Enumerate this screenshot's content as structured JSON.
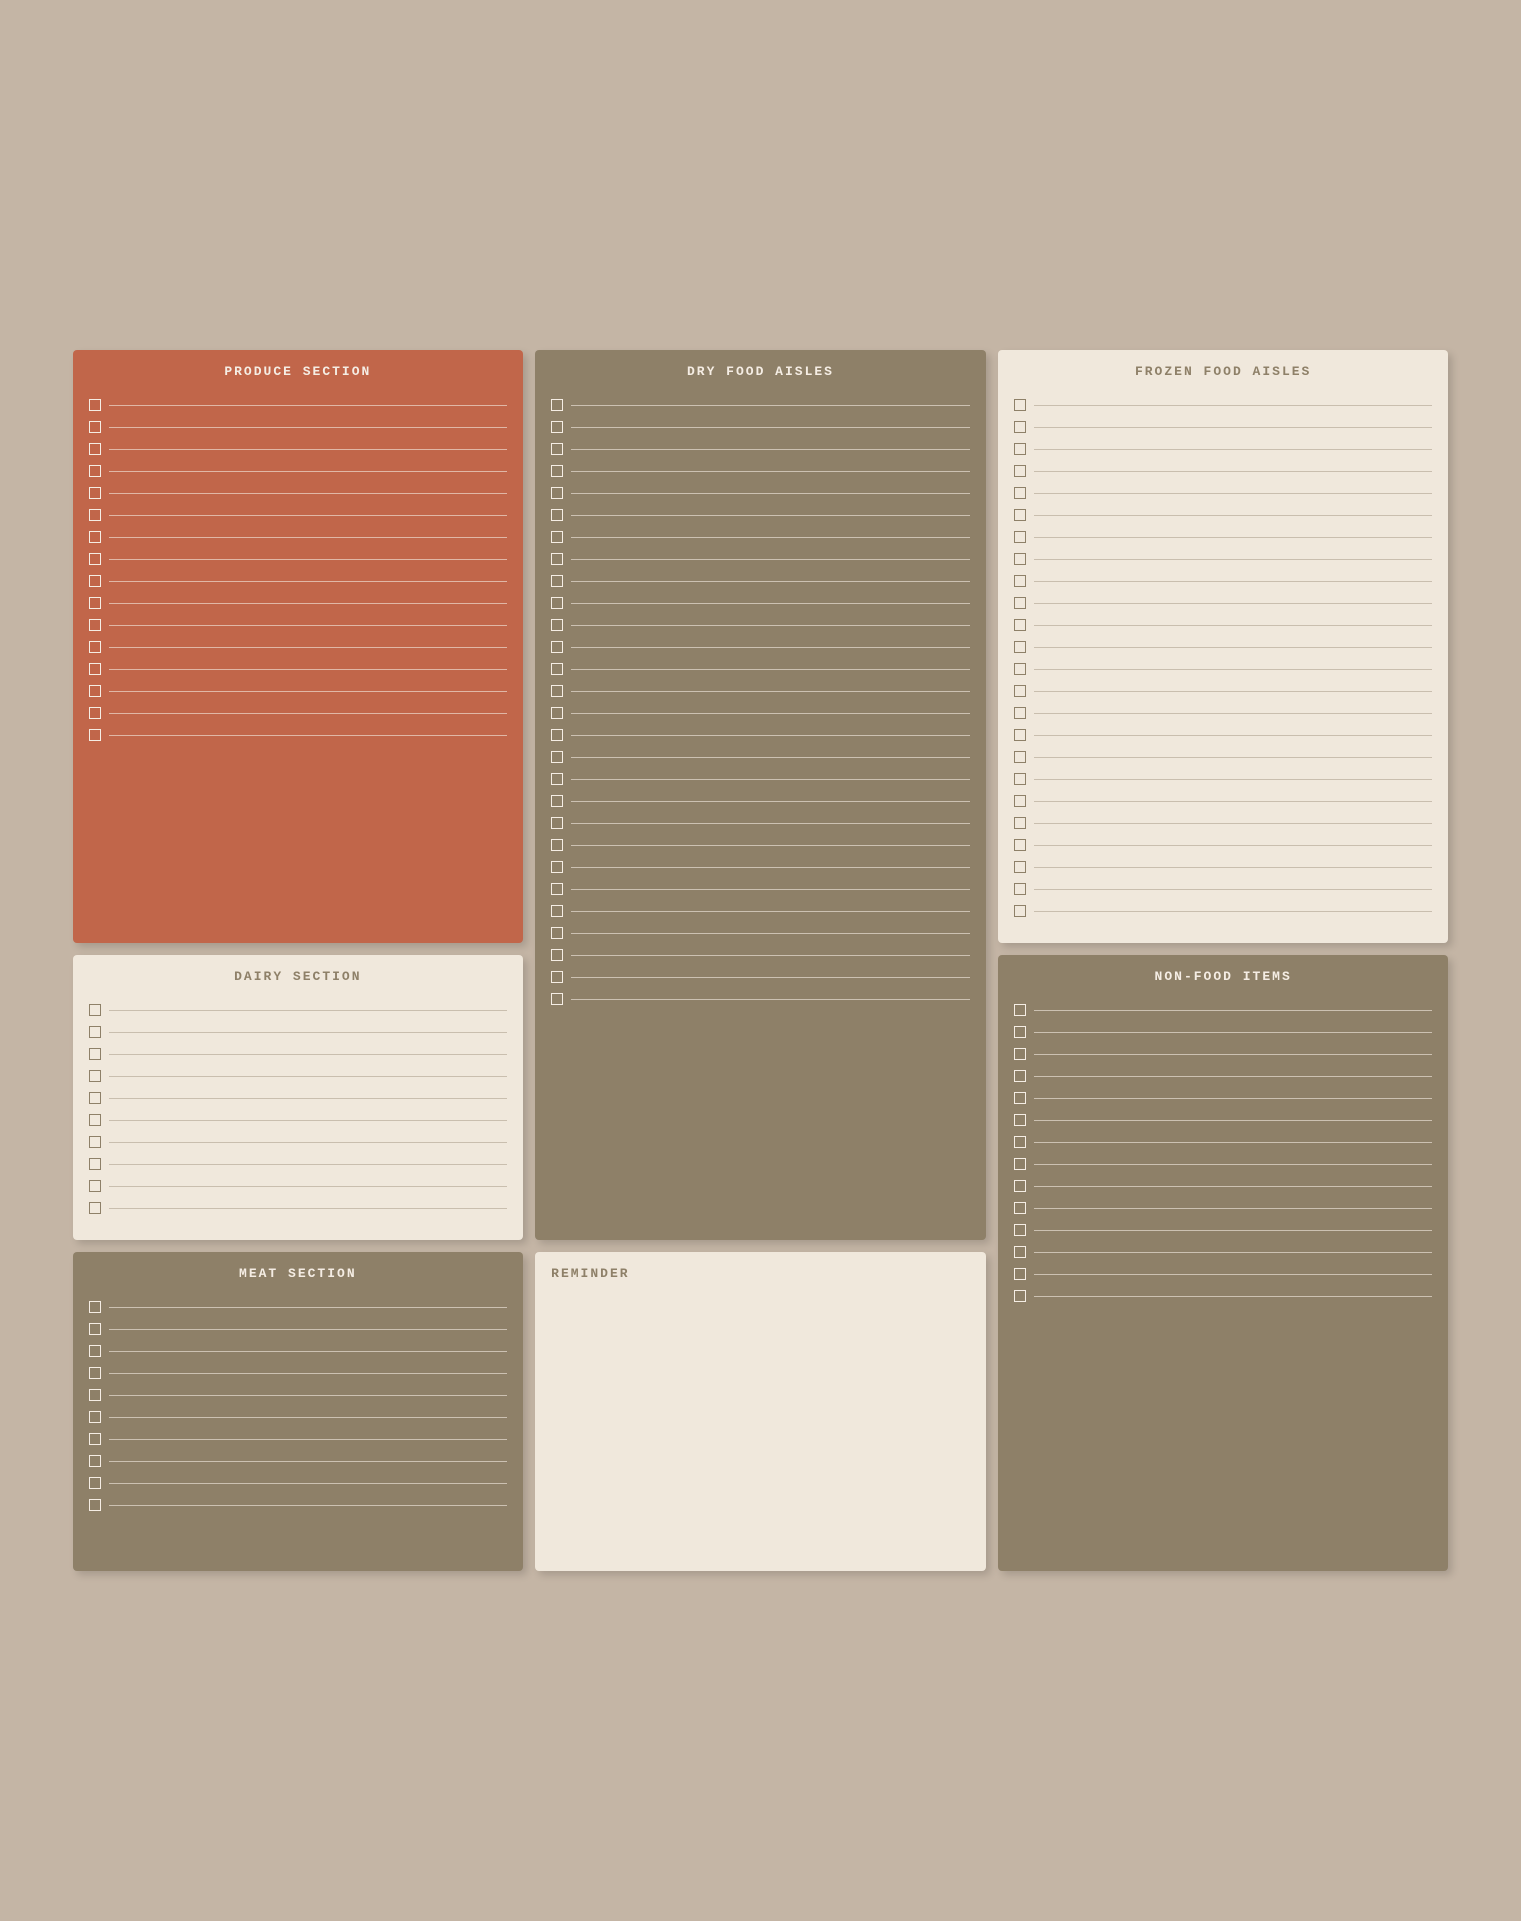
{
  "sections": {
    "produce": {
      "title": "PRODUCE SECTION",
      "items": 16
    },
    "dry_food": {
      "title": "DRY FOOD AISLES",
      "items": 28
    },
    "frozen_food": {
      "title": "FROZEN FOOD AISLES",
      "items": 24
    },
    "dairy": {
      "title": "DAIRY SECTION",
      "items": 10
    },
    "meat": {
      "title": "MEAT SECTION",
      "items": 10
    },
    "reminder": {
      "title": "REMINDER"
    },
    "non_food": {
      "title": "NON-FOOD ITEMS",
      "items": 14
    }
  }
}
